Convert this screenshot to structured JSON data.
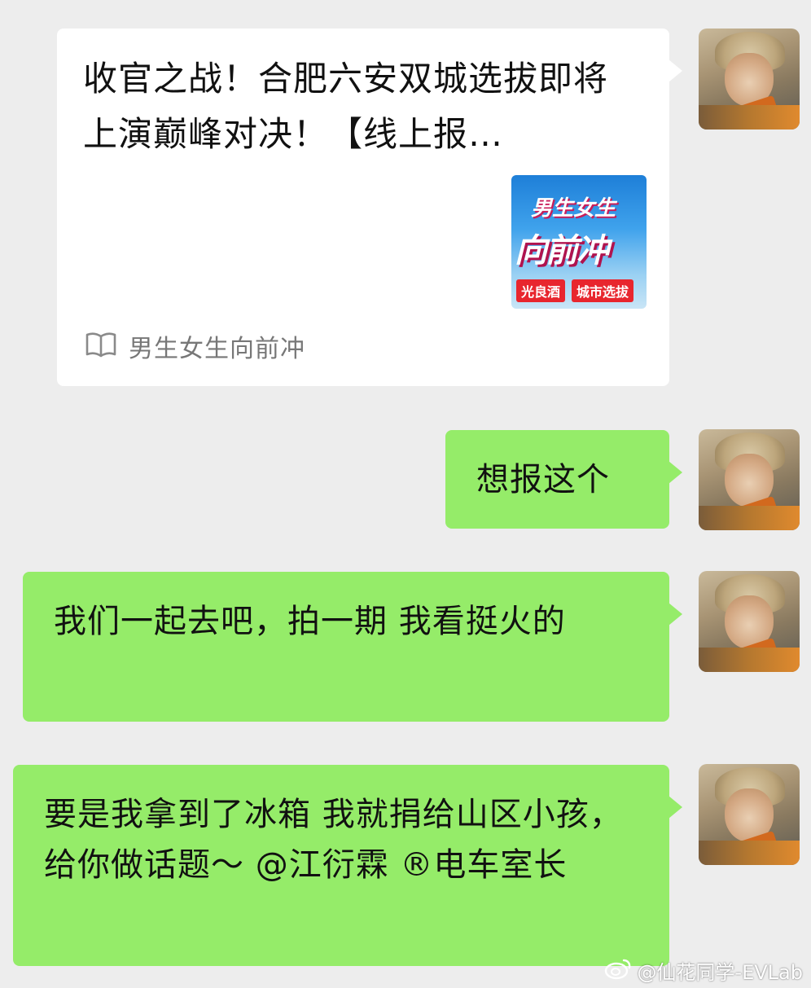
{
  "messages": [
    {
      "type": "link-card",
      "title": "收官之战！合肥六安双城选拔即将上演巅峰对决！【线上报…",
      "thumbnail": {
        "title_line1": "男生女生",
        "title_line2": "向前冲",
        "tag1": "光良酒",
        "tag2": "城市选拔"
      },
      "source_icon": "book-open-icon",
      "source": "男生女生向前冲"
    },
    {
      "type": "text",
      "text": "想报这个"
    },
    {
      "type": "text",
      "text": "我们一起去吧，拍一期 我看挺火的"
    },
    {
      "type": "text",
      "text": "要是我拿到了冰箱 我就捐给山区小孩， 给你做话题～ @江衍霖 ®电车室长"
    }
  ],
  "watermark": {
    "icon": "weibo-icon",
    "text": "@仙花同学-EVLab"
  },
  "colors": {
    "background": "#ededed",
    "sent_bubble": "#95ec69",
    "card_bubble": "#ffffff"
  }
}
